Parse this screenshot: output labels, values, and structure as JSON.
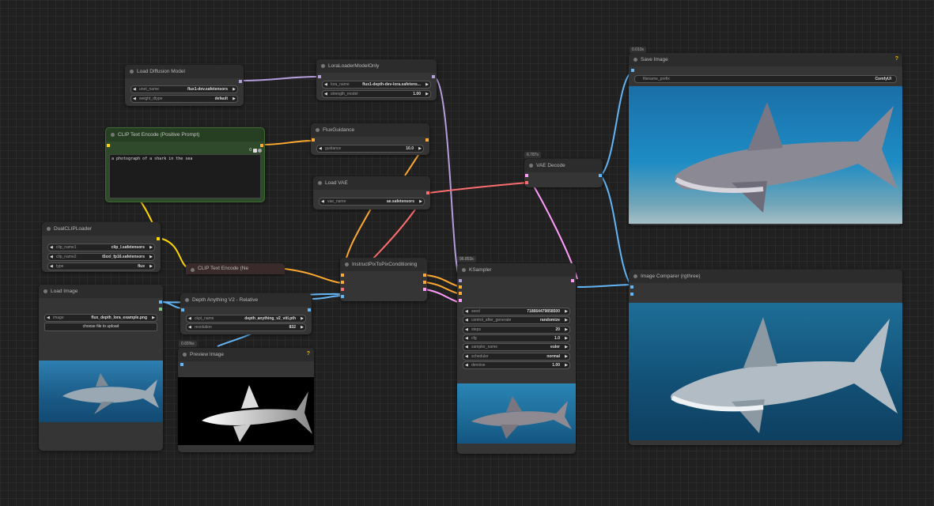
{
  "colors": {
    "model": "#b39ddb",
    "clip": "#ffd500",
    "conditioning": "#ffa931",
    "vae": "#ff6e6e",
    "latent": "#ff9cf9",
    "image": "#64b5f6",
    "mask": "#81c784"
  },
  "nodes": {
    "load_diffusion": {
      "title": "Load Diffusion Model",
      "w1_label": "unet_name",
      "w1_value": "flux1-dev.safetensors",
      "w2_label": "weight_dtype",
      "w2_value": "default"
    },
    "lora": {
      "title": "LoraLoaderModelOnly",
      "w1_label": "lora_name",
      "w1_value": "flux1-depth-dev-lora.safetens...",
      "w2_label": "strength_model",
      "w2_value": "1.00"
    },
    "clip_pos": {
      "title": "CLIP Text Encode (Positive Prompt)",
      "text": "a photograph of a shark in the sea",
      "counter": "0"
    },
    "flux_guidance": {
      "title": "FluxGuidance",
      "w1_label": "guidance",
      "w1_value": "10.0"
    },
    "load_vae": {
      "title": "Load VAE",
      "w1_label": "vae_name",
      "w1_value": "ae.safetensors"
    },
    "dual_clip": {
      "title": "DualCLIPLoader",
      "w1_label": "clip_name1",
      "w1_value": "clip_l.safetensors",
      "w2_label": "clip_name2",
      "w2_value": "t5xxl_fp16.safetensors",
      "w3_label": "type",
      "w3_value": "flux"
    },
    "clip_neg": {
      "title": "CLIP Text Encode (Ne"
    },
    "instruct": {
      "title": "InstructPixToPixConditioning"
    },
    "load_image": {
      "title": "Load Image",
      "w1_label": "image",
      "w1_value": "flux_depth_lora_example.png",
      "button": "choose file to upload"
    },
    "depth": {
      "title": "Depth Anything V2 - Relative",
      "w1_label": "ckpt_name",
      "w1_value": "depth_anything_v2_vitl.pth",
      "w2_label": "resolution",
      "w2_value": "832"
    },
    "preview": {
      "title": "Preview Image",
      "badge": "0.65%s",
      "warn": "?"
    },
    "vae_decode": {
      "title": "VAE Decode",
      "badge": "6.787s"
    },
    "ksampler": {
      "title": "KSampler",
      "badge": "96.853s",
      "widgets": [
        {
          "label": "seed",
          "value": "718664479858500"
        },
        {
          "label": "control_after_generate",
          "value": "randomize"
        },
        {
          "label": "steps",
          "value": "20"
        },
        {
          "label": "cfg",
          "value": "1.0"
        },
        {
          "label": "sampler_name",
          "value": "euler"
        },
        {
          "label": "scheduler",
          "value": "normal"
        },
        {
          "label": "denoise",
          "value": "1.00"
        }
      ]
    },
    "save": {
      "title": "Save Image",
      "badge": "0.010s",
      "warn": "?",
      "w1_label": "filename_prefix",
      "w1_value": "ComfyUI"
    },
    "comparer": {
      "title": "Image Comparer (rgthree)"
    }
  },
  "icons": {
    "arrow_left": "◀",
    "arrow_right": "▶"
  }
}
